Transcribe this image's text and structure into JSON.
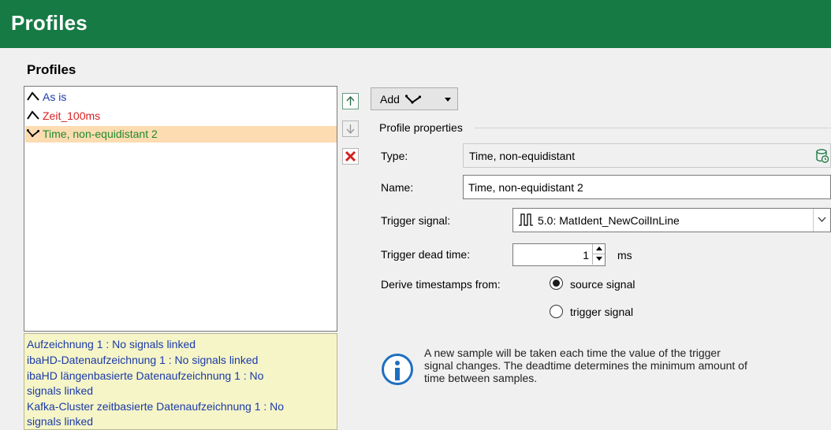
{
  "window": {
    "title": "Profiles"
  },
  "section": {
    "title": "Profiles"
  },
  "profiles": [
    {
      "label": "As is",
      "color": "#1c3aa8",
      "icon": "profile-curve-icon"
    },
    {
      "label": "Zeit_100ms",
      "color": "#d92020",
      "icon": "profile-curve-icon"
    },
    {
      "label": "Time, non-equidistant 2",
      "color": "#1e8a2a",
      "icon": "profile-nonequidistant-icon",
      "selected": true
    }
  ],
  "recordings": [
    "Aufzeichnung 1 : No signals linked",
    "ibaHD-Datenaufzeichnung 1 : No signals linked",
    "ibaHD längenbasierte Datenaufzeichnung 1 : No",
    "signals linked",
    "Kafka-Cluster zeitbasierte Datenaufzeichnung 1 : No",
    "signals linked"
  ],
  "toolbar": {
    "add_label": "Add"
  },
  "properties": {
    "group_label": "Profile properties",
    "type_label": "Type:",
    "type_value": "Time, non-equidistant",
    "name_label": "Name:",
    "name_value": "Time, non-equidistant 2",
    "trigger_signal_label": "Trigger signal:",
    "trigger_signal_value": "5.0: MatIdent_NewCoilInLine",
    "trigger_dead_time_label": "Trigger dead time:",
    "trigger_dead_time_value": "1",
    "trigger_dead_time_unit": "ms",
    "derive_label": "Derive timestamps from:",
    "derive_options": [
      {
        "label": "source signal",
        "checked": true
      },
      {
        "label": "trigger signal",
        "checked": false
      }
    ]
  },
  "info": {
    "lines": [
      "A new sample will be taken each time the value of the trigger",
      "signal changes. The deadtime determines the minimum amount of",
      "time between samples."
    ]
  },
  "colors": {
    "title_bar": "#167a45",
    "selection": "#fddcb2",
    "info_box": "#f5f5c8",
    "info_text": "#1c3aa8",
    "delete": "#d42020"
  }
}
